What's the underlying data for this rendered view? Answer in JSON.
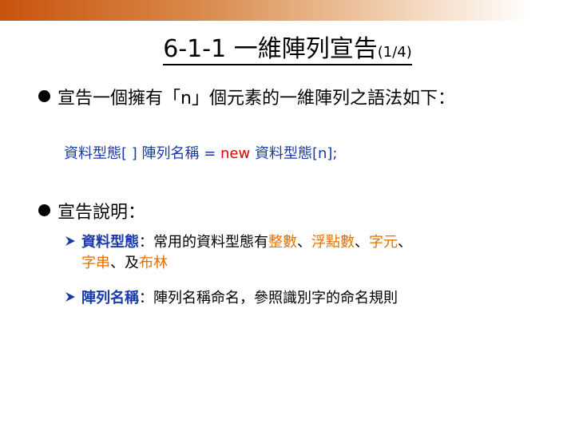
{
  "slide": {
    "title": "6-1-1 一維陣列宣告",
    "title_suffix": "(1/4)"
  },
  "bullet1": {
    "text": "宣告一個擁有「n」個元素的一維陣列之語法如下："
  },
  "code": {
    "part1": "資料型態[ ] 陣列名稱 = ",
    "keyword": "new",
    "part2": " 資料型態[n];"
  },
  "bullet2": {
    "text": "宣告說明："
  },
  "sub1": {
    "term": "資料型態",
    "colon": "：常用的資料型態有",
    "t1": "整數",
    "s1": "、",
    "t2": "浮點數",
    "s2": "、",
    "t3": "字元",
    "s3": "、",
    "t4": "字串",
    "s4": "、及",
    "t5": "布林"
  },
  "sub2": {
    "term": "陣列名稱",
    "text": "：陣列名稱命名，參照識別字的命名規則"
  },
  "colors": {
    "term_blue": "#1a3aa8",
    "keyword_red": "#e00000",
    "highlight_orange": "#e07000",
    "arrow_blue": "#1a3aa8",
    "top_bar_orange": "#c8530c"
  },
  "icons": {
    "bullet": "filled-circle",
    "sub_bullet": "arrowhead-right"
  }
}
